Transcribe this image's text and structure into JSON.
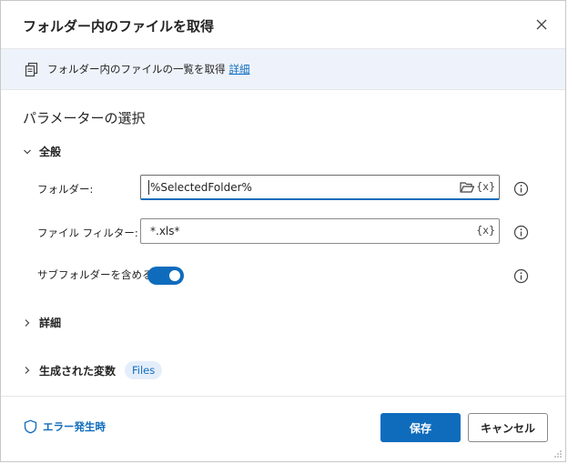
{
  "dialog": {
    "title": "フォルダー内のファイルを取得",
    "close_icon": "close-icon"
  },
  "info": {
    "icon": "files-icon",
    "description": "フォルダー内のファイルの一覧を取得",
    "link": "詳細"
  },
  "params": {
    "heading": "パラメーターの選択",
    "general_group": "全般",
    "folder": {
      "label": "フォルダー:",
      "value": "%SelectedFolder%",
      "vars_button": "{x}"
    },
    "file_filter": {
      "label": "ファイル フィルター:",
      "value": "*.xls*",
      "vars_button": "{x}"
    },
    "include_subfolders": {
      "label": "サブフォルダーを含める:",
      "on": true
    },
    "advanced_group": "詳細",
    "produced_vars_group": "生成された変数",
    "produced_var_badge": "Files"
  },
  "footer": {
    "on_error": "エラー発生時",
    "save": "保存",
    "cancel": "キャンセル"
  },
  "colors": {
    "accent": "#0f6cbd",
    "info_bar": "#eef3fb"
  }
}
